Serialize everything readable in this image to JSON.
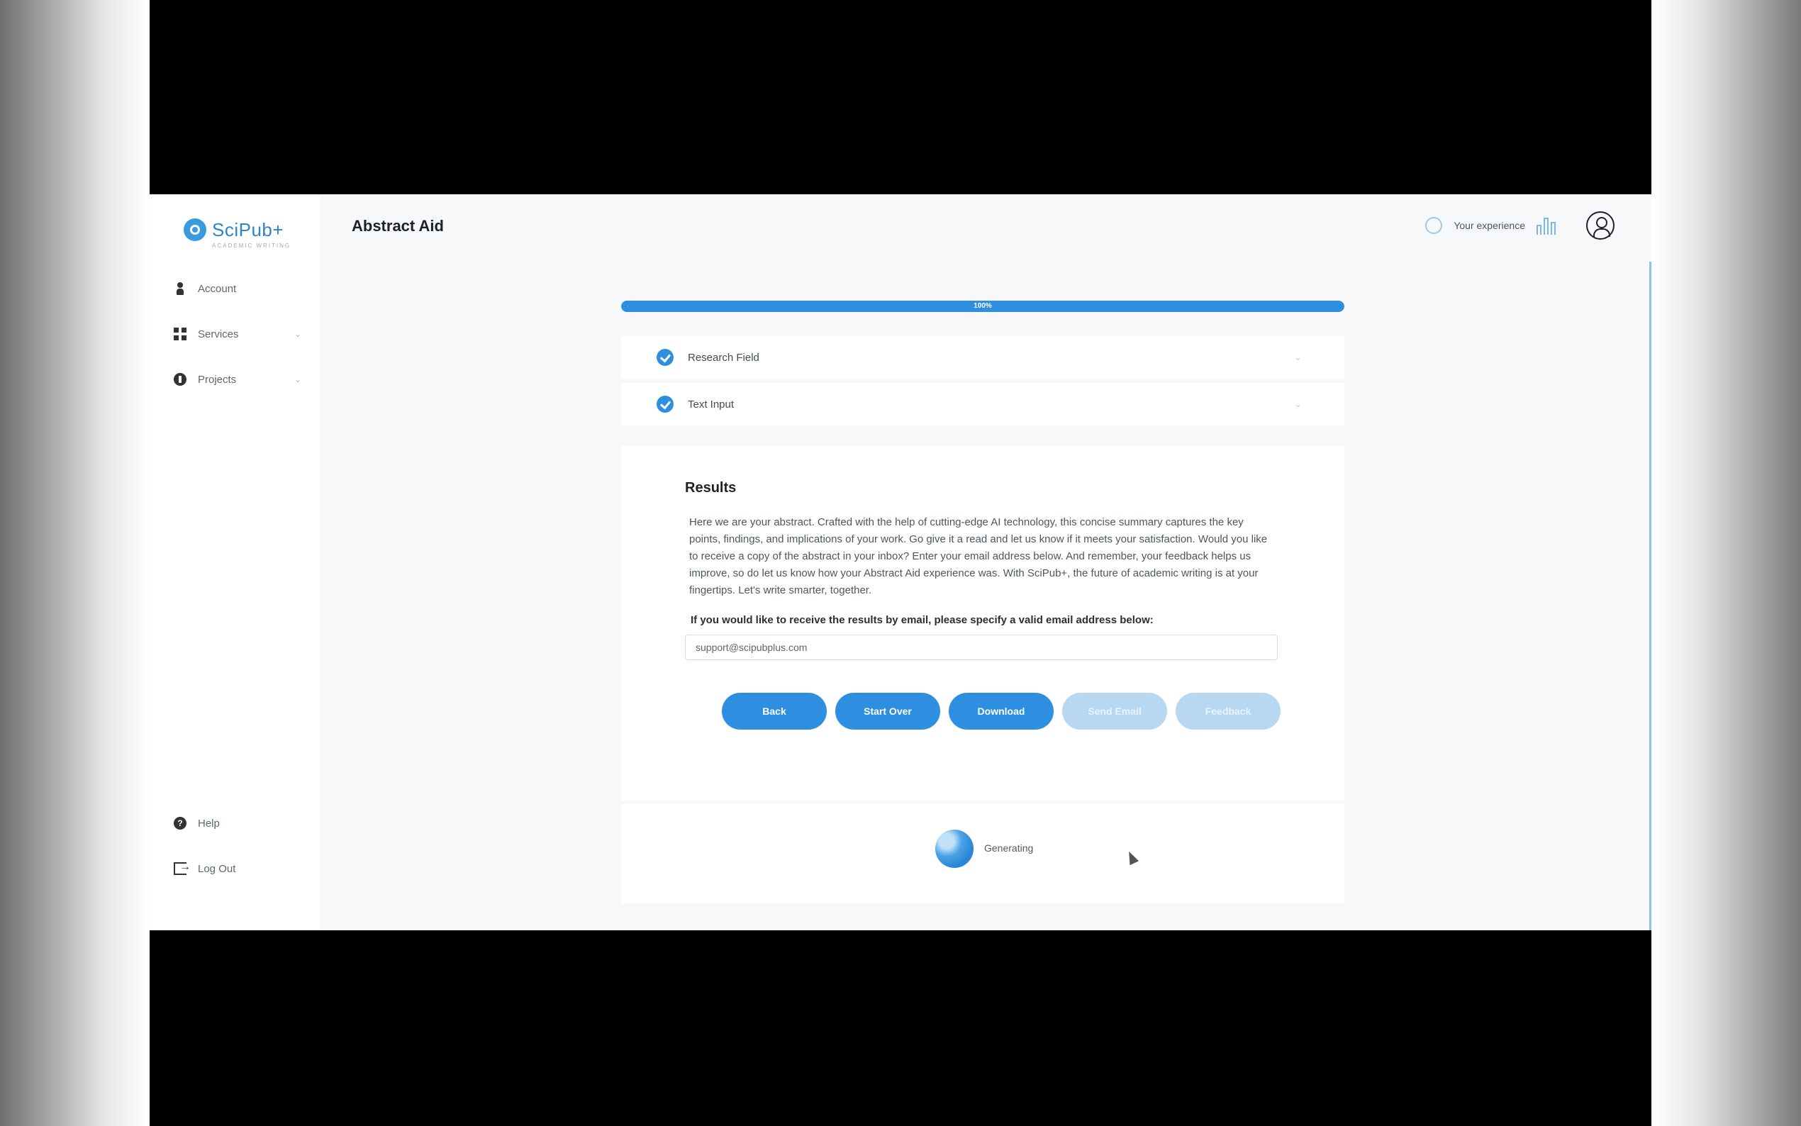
{
  "app": {
    "name": "SciPub+",
    "tagline": "ACADEMIC WRITING"
  },
  "header": {
    "title": "Abstract Aid",
    "experience_label": "Your experience"
  },
  "sidebar": {
    "items": [
      {
        "label": "Account"
      },
      {
        "label": "Services"
      },
      {
        "label": "Projects"
      }
    ],
    "bottom_items": [
      {
        "label": "Help"
      },
      {
        "label": "Log Out"
      }
    ]
  },
  "progress": {
    "percent": 100,
    "text": "100%"
  },
  "steps": [
    {
      "label": "Research Field"
    },
    {
      "label": "Text Input"
    }
  ],
  "results": {
    "title": "Results",
    "body": "Here we are your abstract. Crafted with the help of cutting-edge AI technology, this concise summary captures the key points, findings, and implications of your work. Go give it a read and let us know if it meets your satisfaction. Would you like to receive a copy of the abstract in your inbox? Enter your email address below. And remember, your feedback helps us improve, so do let us know how your Abstract Aid experience was. With SciPub+, the future of academic writing is at your fingertips. Let's write smarter, together.",
    "email_prompt": "If you would like to receive the results by email, please specify a valid email address below:",
    "email_value": "support@scipubplus.com",
    "buttons": [
      {
        "label": "Back",
        "enabled": true
      },
      {
        "label": "Start Over",
        "enabled": true
      },
      {
        "label": "Download",
        "enabled": true
      },
      {
        "label": "Send Email",
        "enabled": false
      },
      {
        "label": "Feedback",
        "enabled": false
      }
    ]
  },
  "footer": {
    "status": "Generating"
  },
  "colors": {
    "accent": "#2e8fe0",
    "accent_disabled": "#b8d8f1",
    "letterbox": "#000000"
  }
}
